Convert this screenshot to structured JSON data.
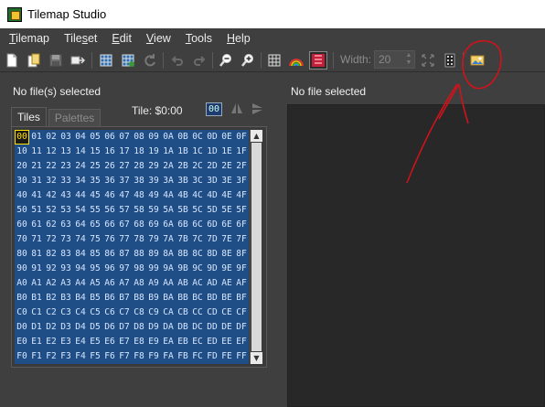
{
  "window": {
    "title": "Tilemap Studio"
  },
  "menu": [
    {
      "label": "Tilemap",
      "accel": "T",
      "rest": "ilemap"
    },
    {
      "label": "Tileset",
      "accel": "",
      "pre": "Tile",
      "u": "s",
      "post": "et"
    },
    {
      "label": "Edit",
      "accel": "E",
      "rest": "dit"
    },
    {
      "label": "View",
      "accel": "V",
      "rest": "iew"
    },
    {
      "label": "Tools",
      "accel": "T",
      "rest": "ools"
    },
    {
      "label": "Help",
      "accel": "H",
      "rest": "elp"
    }
  ],
  "toolbar": {
    "icons": [
      "new-file-icon",
      "open-file-icon",
      "save-icon",
      "export-icon",
      "load-tileset-icon",
      "reload-tileset-icon",
      "refresh-icon",
      "undo-icon",
      "redo-icon",
      "zoom-out-icon",
      "zoom-in-icon",
      "grid-icon",
      "rainbow-icon",
      "attributes-icon",
      "resize-icon",
      "transform-icon",
      "image-to-tiles-icon"
    ],
    "width_label": "Width:",
    "width_value": "20"
  },
  "left": {
    "status": "No file(s) selected",
    "tabs": [
      "Tiles",
      "Palettes"
    ],
    "active_tab": "Tiles",
    "tile_label": "Tile: $0:00",
    "tile_badge": "00",
    "hex_rows": [
      [
        "00",
        "01",
        "02",
        "03",
        "04",
        "05",
        "06",
        "07",
        "08",
        "09",
        "0A",
        "0B",
        "0C",
        "0D",
        "0E",
        "0F"
      ],
      [
        "10",
        "11",
        "12",
        "13",
        "14",
        "15",
        "16",
        "17",
        "18",
        "19",
        "1A",
        "1B",
        "1C",
        "1D",
        "1E",
        "1F"
      ],
      [
        "20",
        "21",
        "22",
        "23",
        "24",
        "25",
        "26",
        "27",
        "28",
        "29",
        "2A",
        "2B",
        "2C",
        "2D",
        "2E",
        "2F"
      ],
      [
        "30",
        "31",
        "32",
        "33",
        "34",
        "35",
        "36",
        "37",
        "38",
        "39",
        "3A",
        "3B",
        "3C",
        "3D",
        "3E",
        "3F"
      ],
      [
        "40",
        "41",
        "42",
        "43",
        "44",
        "45",
        "46",
        "47",
        "48",
        "49",
        "4A",
        "4B",
        "4C",
        "4D",
        "4E",
        "4F"
      ],
      [
        "50",
        "51",
        "52",
        "53",
        "54",
        "55",
        "56",
        "57",
        "58",
        "59",
        "5A",
        "5B",
        "5C",
        "5D",
        "5E",
        "5F"
      ],
      [
        "60",
        "61",
        "62",
        "63",
        "64",
        "65",
        "66",
        "67",
        "68",
        "69",
        "6A",
        "6B",
        "6C",
        "6D",
        "6E",
        "6F"
      ],
      [
        "70",
        "71",
        "72",
        "73",
        "74",
        "75",
        "76",
        "77",
        "78",
        "79",
        "7A",
        "7B",
        "7C",
        "7D",
        "7E",
        "7F"
      ],
      [
        "80",
        "81",
        "82",
        "83",
        "84",
        "85",
        "86",
        "87",
        "88",
        "89",
        "8A",
        "8B",
        "8C",
        "8D",
        "8E",
        "8F"
      ],
      [
        "90",
        "91",
        "92",
        "93",
        "94",
        "95",
        "96",
        "97",
        "98",
        "99",
        "9A",
        "9B",
        "9C",
        "9D",
        "9E",
        "9F"
      ],
      [
        "A0",
        "A1",
        "A2",
        "A3",
        "A4",
        "A5",
        "A6",
        "A7",
        "A8",
        "A9",
        "AA",
        "AB",
        "AC",
        "AD",
        "AE",
        "AF"
      ],
      [
        "B0",
        "B1",
        "B2",
        "B3",
        "B4",
        "B5",
        "B6",
        "B7",
        "B8",
        "B9",
        "BA",
        "BB",
        "BC",
        "BD",
        "BE",
        "BF"
      ],
      [
        "C0",
        "C1",
        "C2",
        "C3",
        "C4",
        "C5",
        "C6",
        "C7",
        "C8",
        "C9",
        "CA",
        "CB",
        "CC",
        "CD",
        "CE",
        "CF"
      ],
      [
        "D0",
        "D1",
        "D2",
        "D3",
        "D4",
        "D5",
        "D6",
        "D7",
        "D8",
        "D9",
        "DA",
        "DB",
        "DC",
        "DD",
        "DE",
        "DF"
      ],
      [
        "E0",
        "E1",
        "E2",
        "E3",
        "E4",
        "E5",
        "E6",
        "E7",
        "E8",
        "E9",
        "EA",
        "EB",
        "EC",
        "ED",
        "EE",
        "EF"
      ],
      [
        "F0",
        "F1",
        "F2",
        "F3",
        "F4",
        "F5",
        "F6",
        "F7",
        "F8",
        "F9",
        "FA",
        "FB",
        "FC",
        "FD",
        "FE",
        "FF"
      ]
    ],
    "selected_tile": "00"
  },
  "right": {
    "status": "No file selected"
  },
  "colors": {
    "window_bg": "#3f3f3f",
    "tile_grid_bg": "#1f4d85",
    "selection": "#ffe100",
    "annotation": "#d0131b",
    "canvas_bg": "#282828"
  }
}
